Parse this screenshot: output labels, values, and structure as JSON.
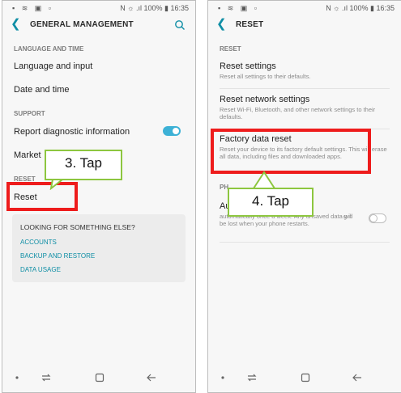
{
  "left_screen": {
    "status": {
      "icons": "▪ ≋ ▣ ▫",
      "battery": "N ☼ .ıl 100% ▮ 16:35"
    },
    "title": "GENERAL MANAGEMENT",
    "sections": {
      "language_and_time": "LANGUAGE AND TIME",
      "support": "SUPPORT",
      "reset": "RESET"
    },
    "items": {
      "language_input": "Language and input",
      "date_time": "Date and time",
      "report": "Report diagnostic information",
      "market": "Market",
      "reset": "Reset"
    },
    "card": {
      "title": "LOOKING FOR SOMETHING ELSE?",
      "links": [
        "ACCOUNTS",
        "BACKUP AND RESTORE",
        "DATA USAGE"
      ]
    },
    "report_toggle": "on",
    "callout": "3. Tap"
  },
  "right_screen": {
    "status": {
      "icons": "▪ ≋ ▣ ▫",
      "battery": "N ☼ .ıl 100% ▮ 16:35"
    },
    "title": "RESET",
    "sections": {
      "reset": "RESET",
      "partial": "PH"
    },
    "items": {
      "reset_settings": {
        "title": "Reset settings",
        "sub": "Reset all settings to their defaults."
      },
      "reset_network": {
        "title": "Reset network settings",
        "sub": "Reset Wi-Fi, Bluetooth, and other network settings to their defaults."
      },
      "factory_reset": {
        "title": "Factory data reset",
        "sub": "Reset your device to its factory default settings. This will erase all data, including files and downloaded apps."
      },
      "auto_restart": {
        "title": "Au",
        "sub": "automatically once a week. Any unsaved data will be lost when your phone restarts.",
        "sub_partial": "g it"
      }
    },
    "auto_restart_toggle": "off",
    "callout": "4. Tap"
  },
  "colors": {
    "accent": "#0f8ea5",
    "toggle_on": "#3db1d6",
    "highlight": "#ee1c1c",
    "callout_border": "#8dc63f"
  },
  "icons": [
    "back-arrow-icon",
    "search-icon",
    "nav-recent-icon",
    "nav-home-icon",
    "nav-back-icon"
  ]
}
